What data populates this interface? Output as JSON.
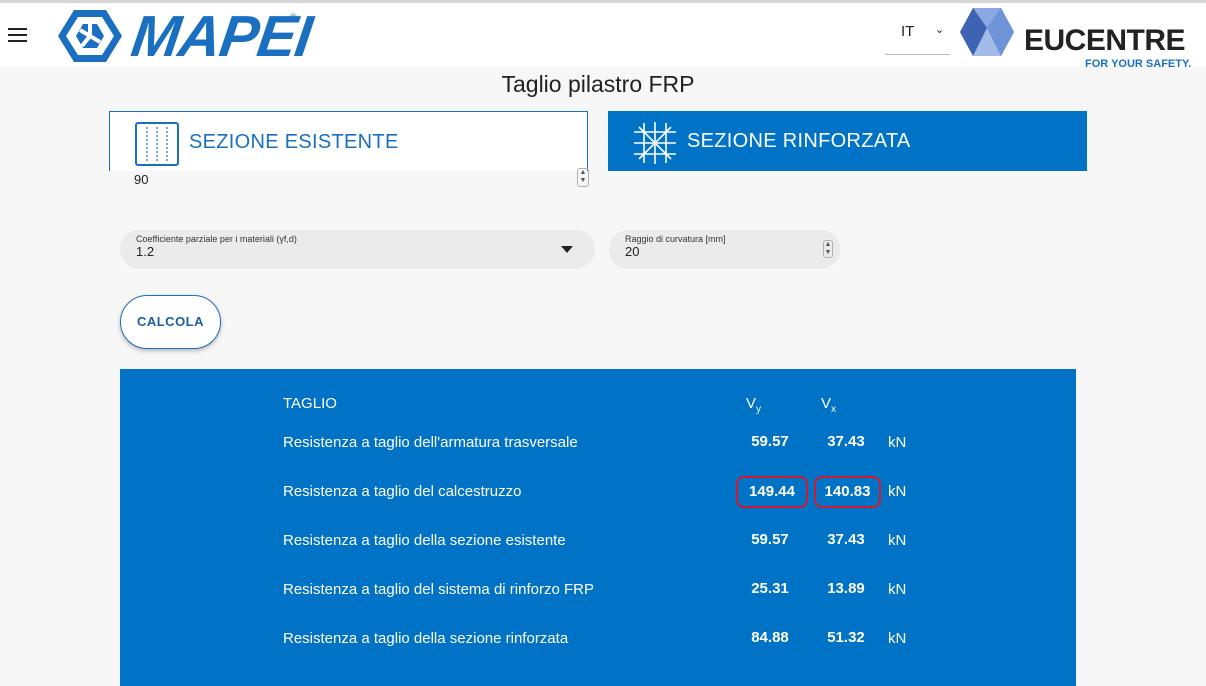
{
  "header": {
    "brand_left": "MAPEI",
    "brand_left_reg": "®",
    "language": "IT",
    "brand_right": "EUCENTRE",
    "brand_right_tagline": "FOR YOUR SAFETY."
  },
  "page": {
    "title": "Taglio pilastro FRP"
  },
  "tabs": [
    {
      "label": "SEZIONE ESISTENTE",
      "icon": "column-section-icon",
      "active": false
    },
    {
      "label": "SEZIONE RINFORZATA",
      "icon": "reinforced-mesh-icon",
      "active": true
    }
  ],
  "form": {
    "partial_field_value": "90",
    "coefficient": {
      "label": "Coefficiente parziale per i materiali (γf,d)",
      "value": "1.2"
    },
    "radius": {
      "label": "Raggio di curvatura [mm]",
      "value": "20"
    },
    "calc_label": "CALCOLA"
  },
  "results": {
    "header": {
      "title": "TAGLIO",
      "vy": "V",
      "vy_sub": "y",
      "vx": "V",
      "vx_sub": "x"
    },
    "rows": [
      {
        "name": "Resistenza a taglio dell'armatura trasversale",
        "vy": "59.57",
        "vx": "37.43",
        "unit": "kN"
      },
      {
        "name": "Resistenza a taglio del calcestruzzo",
        "vy": "149.44",
        "vx": "140.83",
        "unit": "kN",
        "highlight": true
      },
      {
        "name": "Resistenza a taglio della sezione esistente",
        "vy": "59.57",
        "vx": "37.43",
        "unit": "kN"
      },
      {
        "name": "Resistenza a taglio del sistema di rinforzo FRP",
        "vy": "25.31",
        "vx": "13.89",
        "unit": "kN"
      },
      {
        "name": "Resistenza a taglio della sezione rinforzata",
        "vy": "84.88",
        "vx": "51.32",
        "unit": "kN"
      }
    ]
  },
  "colors": {
    "primary": "#0073c6",
    "highlight": "#d41b2e",
    "brand_blue": "#1a6fc0"
  }
}
